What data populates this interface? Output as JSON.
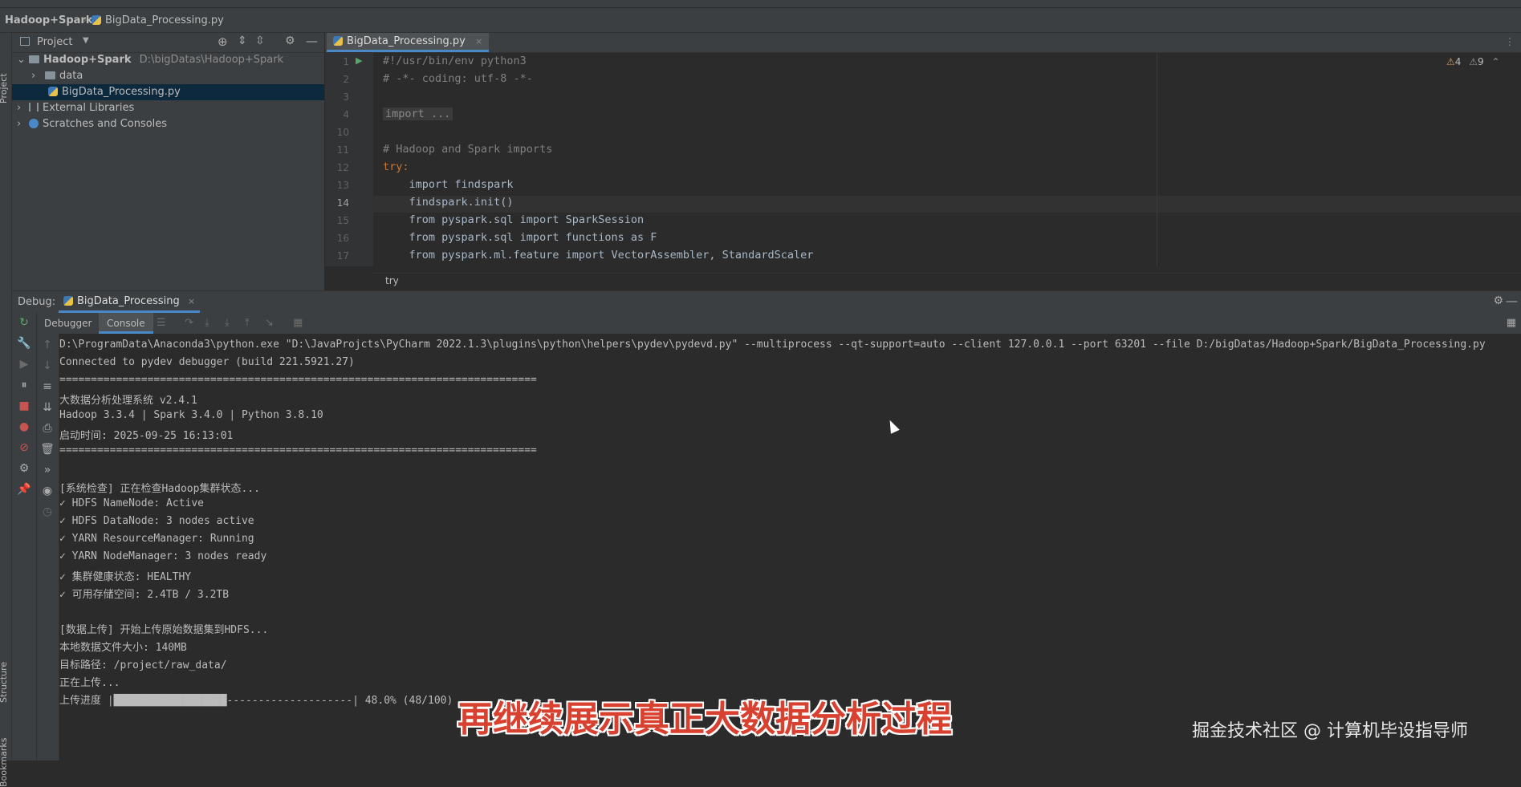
{
  "navbar": {
    "project_name": "Hadoop+Spark",
    "file_name": "BigData_Processing.py",
    "run_config": "BigData_Processing"
  },
  "left_strip": {
    "project_label": "Project",
    "structure_label": "Structure",
    "bookmarks_label": "Bookmarks"
  },
  "project_panel": {
    "title": "Project",
    "tree": [
      {
        "label": "Hadoop+Spark",
        "path": "D:\\bigDatas\\Hadoop+Spark",
        "icon": "folder-icon"
      },
      {
        "label": "data",
        "icon": "folder-icon"
      },
      {
        "label": "BigData_Processing.py",
        "icon": "python-file-icon"
      },
      {
        "label": "External Libraries",
        "icon": "libraries-icon"
      },
      {
        "label": "Scratches and Consoles",
        "icon": "scratches-icon"
      }
    ]
  },
  "editor": {
    "tab_label": "BigData_Processing.py",
    "warnings": "4",
    "weak_warnings": "9",
    "line_numbers": [
      "1",
      "2",
      "3",
      "4",
      "10",
      "11",
      "12",
      "13",
      "14",
      "15",
      "16",
      "17"
    ],
    "lines": [
      "#!/usr/bin/env python3",
      "# -*- coding: utf-8 -*-",
      "",
      "import ...",
      "",
      "# Hadoop and Spark imports",
      "try:",
      "    import findspark",
      "    findspark.init()",
      "    from pyspark.sql import SparkSession",
      "    from pyspark.sql import functions as F",
      "    from pyspark.ml.feature import VectorAssembler, StandardScaler"
    ],
    "breadcrumb": "try"
  },
  "debug": {
    "label": "Debug:",
    "session_tab": "BigData_Processing",
    "tabs": [
      "Debugger",
      "Console"
    ]
  },
  "console": {
    "lines": [
      "D:\\ProgramData\\Anaconda3\\python.exe \"D:\\JavaProjcts\\PyCharm 2022.1.3\\plugins\\python\\helpers\\pydev\\pydevd.py\" --multiprocess --qt-support=auto --client 127.0.0.1 --port 63201 --file D:/bigDatas/Hadoop+Spark/BigData_Processing.py",
      "Connected to pydev debugger (build 221.5921.27)",
      "============================================================================",
      "大数据分析处理系统 v2.4.1",
      "Hadoop 3.3.4 | Spark 3.4.0 | Python 3.8.10",
      "启动时间: 2025-09-25 16:13:01",
      "============================================================================",
      "",
      "[系统检查] 正在检查Hadoop集群状态...",
      "✓ HDFS NameNode: Active",
      "✓ HDFS DataNode: 3 nodes active",
      "✓ YARN ResourceManager: Running",
      "✓ YARN NodeManager: 3 nodes ready",
      "✓ 集群健康状态: HEALTHY",
      "✓ 可用存储空间: 2.4TB / 3.2TB",
      "",
      "[数据上传] 开始上传原始数据集到HDFS...",
      "本地数据文件大小: 140MB",
      "目标路径: /project/raw_data/",
      "正在上传...",
      "上传进度 |██████████████████--------------------| 48.0% (48/100)"
    ]
  },
  "overlay": {
    "subtitle": "再继续展示真正大数据分析过程",
    "watermark": "掘金技术社区 @ 计算机毕设指导师"
  }
}
